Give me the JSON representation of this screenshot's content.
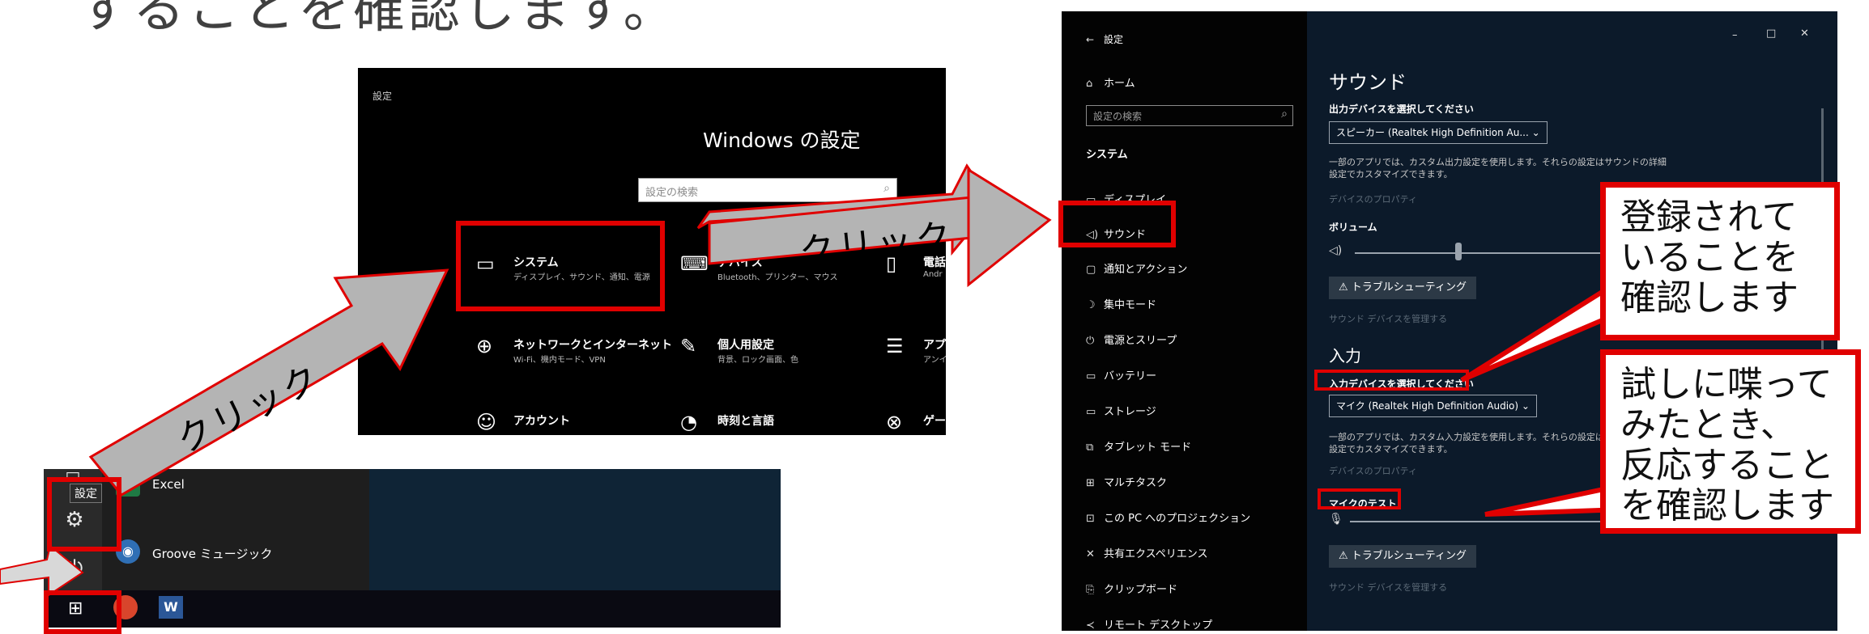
{
  "caption": "することを確認します。",
  "start_menu": {
    "tooltip": "設定",
    "apps": [
      "Excel",
      "Groove ミュージック"
    ]
  },
  "windows_settings": {
    "title": "設定",
    "heading": "Windows の設定",
    "search_placeholder": "設定の検索",
    "categories": [
      {
        "name": "システム",
        "desc": "ディスプレイ、サウンド、通知、電源"
      },
      {
        "name": "デバイス",
        "desc": "Bluetooth、プリンター、マウス"
      },
      {
        "name": "電話",
        "desc": "Andr"
      },
      {
        "name": "ネットワークとインターネット",
        "desc": "Wi-Fi、機内モード、VPN"
      },
      {
        "name": "個人用設定",
        "desc": "背景、ロック画面、色"
      },
      {
        "name": "アプリ",
        "desc": "アンイ"
      },
      {
        "name": "アカウント",
        "desc": ""
      },
      {
        "name": "時刻と言語",
        "desc": ""
      },
      {
        "name": "ゲー",
        "desc": ""
      }
    ]
  },
  "sound_settings": {
    "window_title": "設定",
    "home": "ホーム",
    "search_placeholder": "設定の検索",
    "section": "システム",
    "nav": [
      "ディスプレイ",
      "サウンド",
      "通知とアクション",
      "集中モード",
      "電源とスリープ",
      "バッテリー",
      "ストレージ",
      "タブレット モード",
      "マルチタスク",
      "この PC へのプロジェクション",
      "共有エクスペリエンス",
      "クリップボード",
      "リモート デスクトップ"
    ],
    "heading": "サウンド",
    "output_label": "出力デバイスを選択してください",
    "output_device": "スピーカー (Realtek High Definition Au...",
    "output_desc_1": "一部のアプリでは、カスタム出力設定を使用します。それらの設定はサウンドの詳細",
    "output_desc_2": "設定でカスタマイズできます。",
    "device_properties": "デバイスのプロパティ",
    "volume_label": "ボリューム",
    "troubleshoot": "トラブルシューティング",
    "manage_devices": "サウンド デバイスを管理する",
    "input_heading": "入力",
    "input_label": "入力デバイスを選択してください",
    "input_device": "マイク (Realtek High Definition Audio)",
    "input_desc_1": "一部のアプリでは、カスタム入力設定を使用します。それらの設定は",
    "input_desc_2": "設定でカスタマイズできます。",
    "mic_test": "マイクのテスト",
    "win_min": "–",
    "win_max": "□",
    "win_close": "✕",
    "back": "←"
  },
  "annotations": {
    "click_1": "クリック",
    "click_2": "クリック",
    "callout_1": [
      "登録されて",
      "いることを",
      "確認します"
    ],
    "callout_2": [
      "試しに喋って",
      "みたとき、",
      "反応すること",
      "を確認します"
    ]
  },
  "colors": {
    "annotation_red": "#e00000",
    "arrow_gray": "#b4b4b4"
  }
}
